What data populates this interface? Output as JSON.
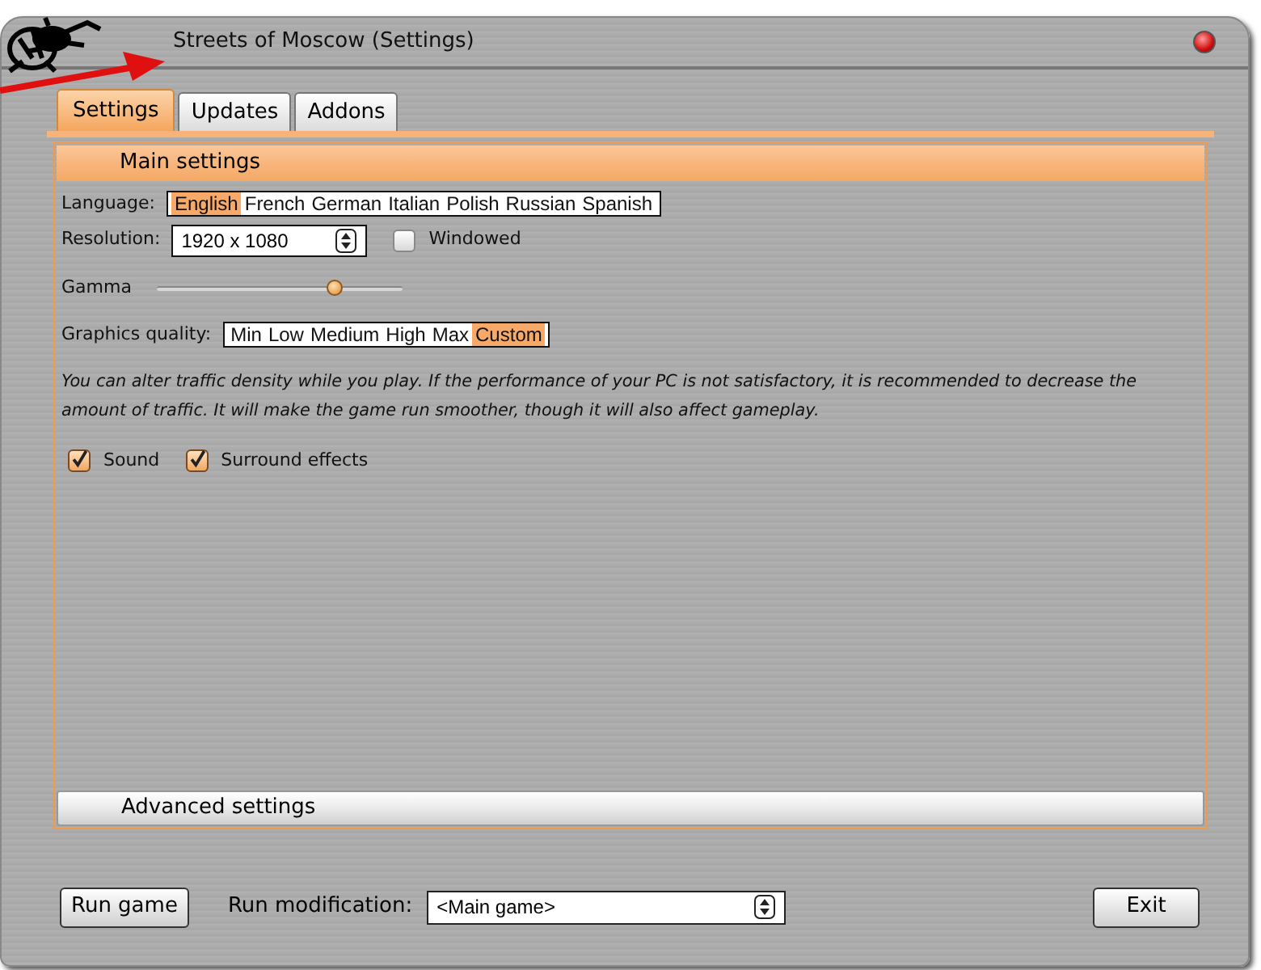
{
  "window": {
    "title": "Streets of Moscow (Settings)"
  },
  "tabs": [
    {
      "label": "Settings",
      "selected": true
    },
    {
      "label": "Updates",
      "selected": false
    },
    {
      "label": "Addons",
      "selected": false
    }
  ],
  "sections": [
    {
      "title": "Main settings",
      "expanded": true
    },
    {
      "title": "Advanced settings",
      "expanded": false
    }
  ],
  "language": {
    "label": "Language:",
    "options": [
      {
        "label": "English",
        "selected": true
      },
      {
        "label": "French",
        "selected": false
      },
      {
        "label": "German",
        "selected": false
      },
      {
        "label": "Italian",
        "selected": false
      },
      {
        "label": "Polish",
        "selected": false
      },
      {
        "label": "Russian",
        "selected": false
      },
      {
        "label": "Spanish",
        "selected": false
      }
    ]
  },
  "resolution": {
    "label": "Resolution:",
    "value": "1920 x 1080"
  },
  "windowed": {
    "label": "Windowed",
    "checked": false
  },
  "gamma": {
    "label": "Gamma",
    "level": 0.72
  },
  "graphics_quality": {
    "label": "Graphics quality:",
    "options": [
      {
        "label": "Min",
        "selected": false
      },
      {
        "label": "Low",
        "selected": false
      },
      {
        "label": "Medium",
        "selected": false
      },
      {
        "label": "High",
        "selected": false
      },
      {
        "label": "Max",
        "selected": false
      },
      {
        "label": "Custom",
        "selected": true
      }
    ]
  },
  "note": "You can alter traffic density while you play. If the performance of your PC is not satisfactory, it is recommended to decrease the amount of traffic. It will make the game run smoother, though it will also affect gameplay.",
  "checkboxes": [
    {
      "label": "Sound",
      "checked": true
    },
    {
      "label": "Surround effects",
      "checked": true
    }
  ],
  "run_button": "Run game",
  "modification": {
    "label": "Run modification:",
    "value": "<Main game>"
  },
  "exit_button": "Exit"
}
